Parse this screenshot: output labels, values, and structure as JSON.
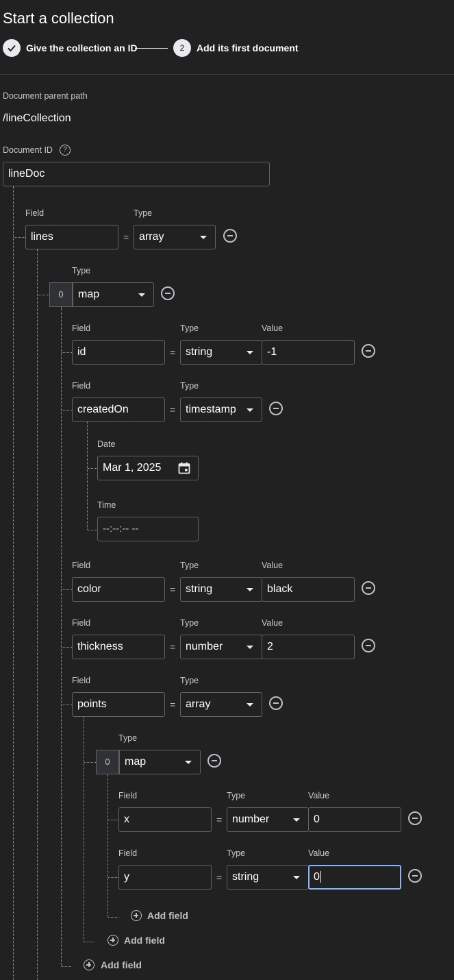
{
  "header": {
    "title": "Start a collection",
    "step1_label": "Give the collection an ID",
    "step2_number": "2",
    "step2_label": "Add its first document"
  },
  "document": {
    "parent_path_label": "Document parent path",
    "parent_path": "/lineCollection",
    "id_label": "Document ID",
    "id_value": "lineDoc",
    "help_glyph": "?"
  },
  "labels": {
    "field": "Field",
    "type": "Type",
    "value": "Value",
    "date": "Date",
    "time": "Time",
    "equals": "=",
    "add_field": "Add field"
  },
  "lines_field": {
    "name": "lines",
    "type": "array"
  },
  "lines_item": {
    "index": "0",
    "type": "map"
  },
  "map_fields": {
    "id": {
      "name": "id",
      "type": "string",
      "value": "-1"
    },
    "createdOn": {
      "name": "createdOn",
      "type": "timestamp",
      "date": "Mar 1, 2025",
      "time": "--:--:-- --"
    },
    "color": {
      "name": "color",
      "type": "string",
      "value": "black"
    },
    "thickness": {
      "name": "thickness",
      "type": "number",
      "value": "2"
    },
    "points": {
      "name": "points",
      "type": "array"
    }
  },
  "points_item": {
    "index": "0",
    "type": "map"
  },
  "point_fields": {
    "x": {
      "name": "x",
      "type": "number",
      "value": "0"
    },
    "y": {
      "name": "y",
      "type": "string",
      "value": "0"
    }
  },
  "icons": {
    "step1": "check-icon",
    "help": "help-icon",
    "remove": "remove-circle-icon",
    "add": "add-circle-icon",
    "calendar": "calendar-icon",
    "dropdown": "dropdown-arrow-icon"
  },
  "colors": {
    "background": "#212121",
    "accent": "#8ab4f8",
    "border": "#5f6368"
  }
}
